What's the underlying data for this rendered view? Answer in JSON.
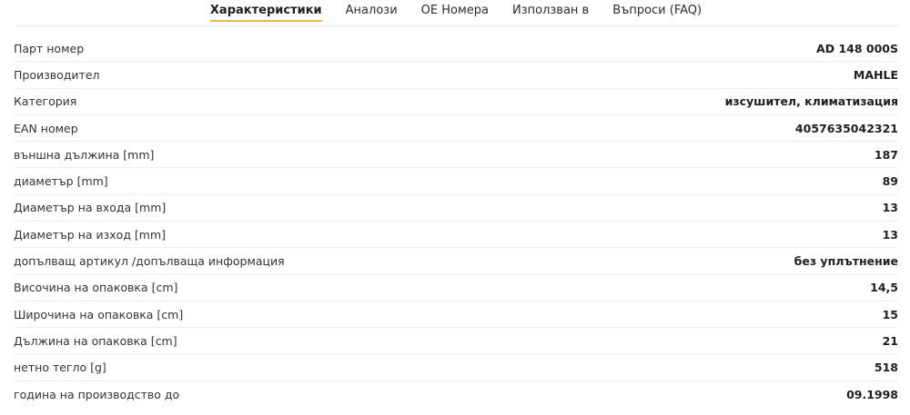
{
  "tabs": [
    {
      "label": "Характеристики",
      "active": true
    },
    {
      "label": "Аналози",
      "active": false
    },
    {
      "label": "ОЕ Номера",
      "active": false
    },
    {
      "label": "Използван в",
      "active": false
    },
    {
      "label": "Въпроси (FAQ)",
      "active": false
    }
  ],
  "specs": [
    {
      "label": "Парт номер",
      "value": "AD 148 000S"
    },
    {
      "label": "Производител",
      "value": "MAHLE"
    },
    {
      "label": "Категория",
      "value": "изсушител, климатизация"
    },
    {
      "label": "EAN номер",
      "value": "4057635042321"
    },
    {
      "label": "външна дължина [mm]",
      "value": "187"
    },
    {
      "label": "диаметър [mm]",
      "value": "89"
    },
    {
      "label": "Диаметър на входа [mm]",
      "value": "13"
    },
    {
      "label": "Диаметър на изход [mm]",
      "value": "13"
    },
    {
      "label": "допълващ артикул /допълваща информация",
      "value": "без уплътнение"
    },
    {
      "label": "Височина на опаковка [cm]",
      "value": "14,5"
    },
    {
      "label": "Широчина на опаковка [cm]",
      "value": "15"
    },
    {
      "label": "Дължина на опаковка [cm]",
      "value": "21"
    },
    {
      "label": "нетно тегло [g]",
      "value": "518"
    },
    {
      "label": "година на производство до",
      "value": "09.1998"
    }
  ],
  "colors": {
    "active_tab_underline": "#e6b84a",
    "divider": "#ececec"
  }
}
